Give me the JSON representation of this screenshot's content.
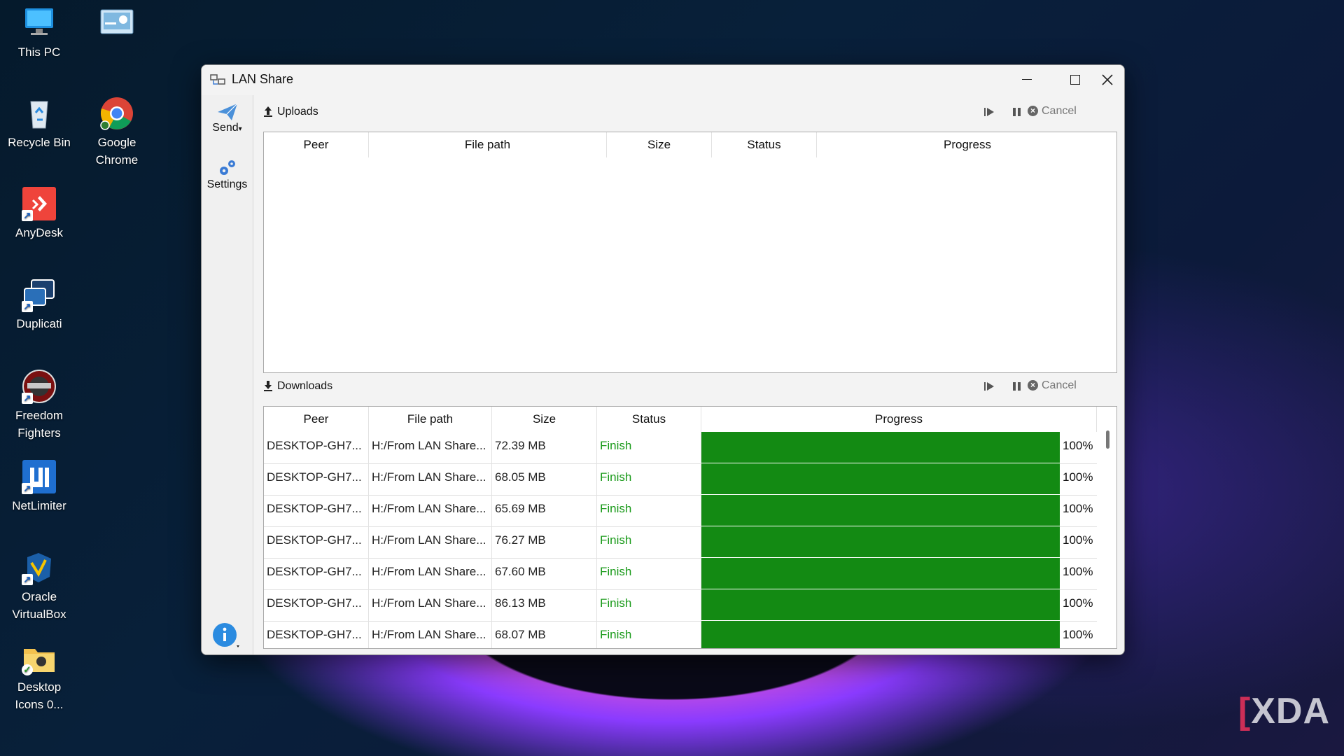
{
  "desktop": {
    "icons": [
      {
        "label": "This PC"
      },
      {
        "label": ""
      },
      {
        "label": "Recycle Bin"
      },
      {
        "label": "Google Chrome"
      },
      {
        "label": "AnyDesk"
      },
      {
        "label": "Duplicati"
      },
      {
        "label": "Freedom Fighters"
      },
      {
        "label": "NetLimiter"
      },
      {
        "label": "Oracle VirtualBox"
      },
      {
        "label": "Desktop Icons 0..."
      }
    ],
    "watermark": "XDA"
  },
  "window": {
    "title": "LAN Share",
    "sidebar": {
      "send_label": "Send",
      "settings_label": "Settings"
    },
    "uploads": {
      "label": "Uploads",
      "cancel_label": "Cancel",
      "columns": [
        "Peer",
        "File path",
        "Size",
        "Status",
        "Progress"
      ]
    },
    "downloads": {
      "label": "Downloads",
      "cancel_label": "Cancel",
      "columns": [
        "Peer",
        "File path",
        "Size",
        "Status",
        "Progress"
      ],
      "rows": [
        {
          "peer": "DESKTOP-GH7...",
          "path": "H:/From LAN Share...",
          "size": "72.39 MB",
          "status": "Finish",
          "progress": 1.0,
          "progress_label": "100%"
        },
        {
          "peer": "DESKTOP-GH7...",
          "path": "H:/From LAN Share...",
          "size": "68.05 MB",
          "status": "Finish",
          "progress": 1.0,
          "progress_label": "100%"
        },
        {
          "peer": "DESKTOP-GH7...",
          "path": "H:/From LAN Share...",
          "size": "65.69 MB",
          "status": "Finish",
          "progress": 1.0,
          "progress_label": "100%"
        },
        {
          "peer": "DESKTOP-GH7...",
          "path": "H:/From LAN Share...",
          "size": "76.27 MB",
          "status": "Finish",
          "progress": 1.0,
          "progress_label": "100%"
        },
        {
          "peer": "DESKTOP-GH7...",
          "path": "H:/From LAN Share...",
          "size": "67.60 MB",
          "status": "Finish",
          "progress": 1.0,
          "progress_label": "100%"
        },
        {
          "peer": "DESKTOP-GH7...",
          "path": "H:/From LAN Share...",
          "size": "86.13 MB",
          "status": "Finish",
          "progress": 1.0,
          "progress_label": "100%"
        },
        {
          "peer": "DESKTOP-GH7...",
          "path": "H:/From LAN Share...",
          "size": "68.07 MB",
          "status": "Finish",
          "progress": 1.0,
          "progress_label": "100%"
        }
      ]
    }
  },
  "colors": {
    "progress_fill": "#138a13",
    "status_finish": "#1a9a1a"
  }
}
